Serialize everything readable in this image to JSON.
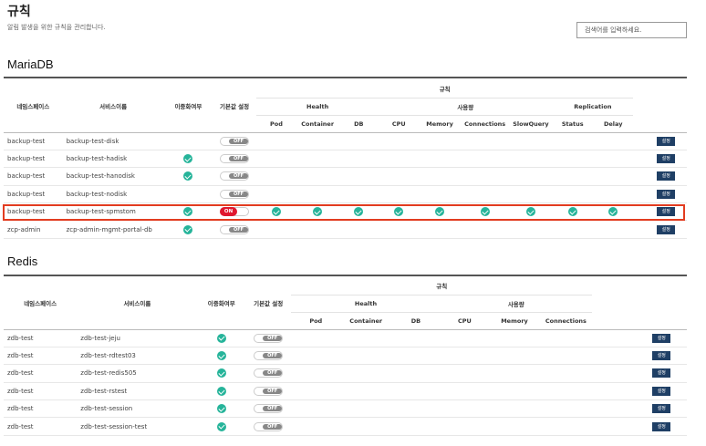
{
  "page": {
    "title": "규칙",
    "subtitle": "알림 발생을 위한 규칙을 관리합니다.",
    "search_placeholder": "검색어를 입력하세요."
  },
  "columns": {
    "namespace": "네임스페이스",
    "service": "서비스이름",
    "redundancy": "이중화여부",
    "default_setting": "기본값 설정",
    "rules": "규칙",
    "health": "Health",
    "usage": "사용량",
    "replication": "Replication"
  },
  "mariadb": {
    "title": "MariaDB",
    "rule_columns": [
      "Pod",
      "Container",
      "DB",
      "CPU",
      "Memory",
      "Connections",
      "SlowQuery",
      "Status",
      "Delay"
    ],
    "rows": [
      {
        "namespace": "backup-test",
        "service": "backup-test-disk",
        "redundancy": false,
        "toggle": "OFF",
        "rules": [
          false,
          false,
          false,
          false,
          false,
          false,
          false,
          false,
          false
        ],
        "button": "설정"
      },
      {
        "namespace": "backup-test",
        "service": "backup-test-hadisk",
        "redundancy": true,
        "toggle": "OFF",
        "rules": [
          false,
          false,
          false,
          false,
          false,
          false,
          false,
          false,
          false
        ],
        "button": "설정"
      },
      {
        "namespace": "backup-test",
        "service": "backup-test-hanodisk",
        "redundancy": true,
        "toggle": "OFF",
        "rules": [
          false,
          false,
          false,
          false,
          false,
          false,
          false,
          false,
          false
        ],
        "button": "설정"
      },
      {
        "namespace": "backup-test",
        "service": "backup-test-nodisk",
        "redundancy": false,
        "toggle": "OFF",
        "rules": [
          false,
          false,
          false,
          false,
          false,
          false,
          false,
          false,
          false
        ],
        "button": "설정"
      },
      {
        "namespace": "backup-test",
        "service": "backup-test-spmstom",
        "redundancy": true,
        "toggle": "ON",
        "rules": [
          true,
          true,
          true,
          true,
          true,
          true,
          true,
          true,
          true
        ],
        "button": "설정"
      },
      {
        "namespace": "zcp-admin",
        "service": "zcp-admin-mgmt-portal-db",
        "redundancy": true,
        "toggle": "OFF",
        "rules": [
          false,
          false,
          false,
          false,
          false,
          false,
          false,
          false,
          false
        ],
        "button": "설정"
      }
    ]
  },
  "redis": {
    "title": "Redis",
    "rule_columns": [
      "Pod",
      "Container",
      "DB",
      "CPU",
      "Memory",
      "Connections"
    ],
    "rows": [
      {
        "namespace": "zdb-test",
        "service": "zdb-test-jeju",
        "redundancy": true,
        "toggle": "OFF",
        "button": "설정"
      },
      {
        "namespace": "zdb-test",
        "service": "zdb-test-rdtest03",
        "redundancy": true,
        "toggle": "OFF",
        "button": "설정"
      },
      {
        "namespace": "zdb-test",
        "service": "zdb-test-redis505",
        "redundancy": true,
        "toggle": "OFF",
        "button": "설정"
      },
      {
        "namespace": "zdb-test",
        "service": "zdb-test-rstest",
        "redundancy": true,
        "toggle": "OFF",
        "button": "설정"
      },
      {
        "namespace": "zdb-test",
        "service": "zdb-test-session",
        "redundancy": true,
        "toggle": "OFF",
        "button": "설정"
      },
      {
        "namespace": "zdb-test",
        "service": "zdb-test-session-test",
        "redundancy": true,
        "toggle": "OFF",
        "button": "설정"
      }
    ]
  },
  "colors": {
    "check": "#26b49a",
    "on": "#e0182f",
    "off": "#888888",
    "button": "#1f3f65",
    "highlight": "#e23c20"
  },
  "icons": {
    "check": "check-circle-icon"
  }
}
